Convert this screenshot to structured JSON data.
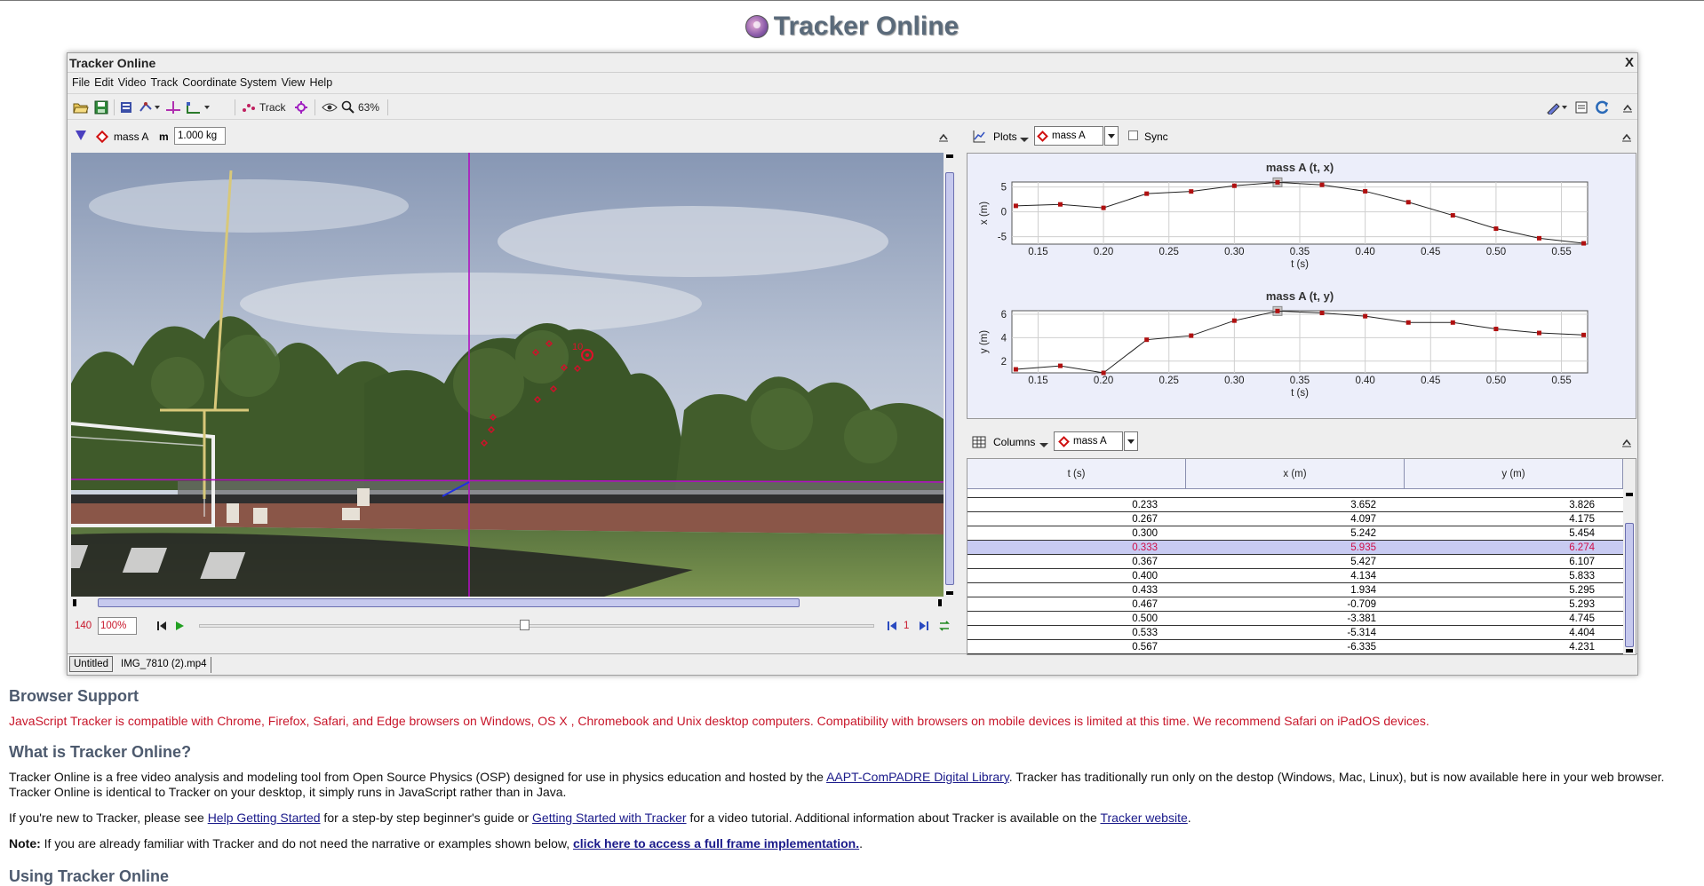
{
  "site": {
    "title": "Tracker Online"
  },
  "window": {
    "title": "Tracker Online",
    "close": "X"
  },
  "menu": [
    "File",
    "Edit",
    "Video",
    "Track",
    "Coordinate System",
    "View",
    "Help"
  ],
  "toolbar": {
    "track_label": "Track",
    "zoom": "63%"
  },
  "track_bar": {
    "name": "mass A",
    "mass_label": "m",
    "mass_value": "1.000 kg"
  },
  "player": {
    "frame": "140",
    "rate": "100%",
    "step": "1"
  },
  "tabs": [
    "Untitled",
    "IMG_7810 (2).mp4"
  ],
  "point_label": "10",
  "plots": {
    "label": "Plots",
    "track": "mass A",
    "sync": "Sync"
  },
  "chart_data": [
    {
      "type": "line",
      "title": "mass A (t, x)",
      "xlabel": "t (s)",
      "ylabel": "x (m)",
      "xlim": [
        0.13,
        0.57
      ],
      "ylim": [
        -6.5,
        6.0
      ],
      "xticks": [
        "0.15",
        "0.20",
        "0.25",
        "0.30",
        "0.35",
        "0.40",
        "0.45",
        "0.50",
        "0.55"
      ],
      "yticks": [
        "5",
        "0",
        "-5"
      ],
      "x": [
        0.133,
        0.167,
        0.2,
        0.233,
        0.267,
        0.3,
        0.333,
        0.367,
        0.4,
        0.433,
        0.467,
        0.5,
        0.533,
        0.567
      ],
      "y": [
        1.2,
        1.5,
        0.8,
        3.652,
        4.097,
        5.242,
        5.935,
        5.427,
        4.134,
        1.934,
        -0.709,
        -3.381,
        -5.314,
        -6.335
      ],
      "highlight_x": 0.333,
      "grid": true
    },
    {
      "type": "line",
      "title": "mass A (t, y)",
      "xlabel": "t (s)",
      "ylabel": "y (m)",
      "xlim": [
        0.13,
        0.57
      ],
      "ylim": [
        1.0,
        6.3
      ],
      "xticks": [
        "0.15",
        "0.20",
        "0.25",
        "0.30",
        "0.35",
        "0.40",
        "0.45",
        "0.50",
        "0.55"
      ],
      "yticks": [
        "6",
        "4",
        "2"
      ],
      "x": [
        0.133,
        0.167,
        0.2,
        0.233,
        0.267,
        0.3,
        0.333,
        0.367,
        0.4,
        0.433,
        0.467,
        0.5,
        0.533,
        0.567
      ],
      "y": [
        1.3,
        1.6,
        1.0,
        3.826,
        4.175,
        5.454,
        6.274,
        6.107,
        5.833,
        5.295,
        5.293,
        4.745,
        4.404,
        4.231
      ],
      "highlight_x": 0.333,
      "grid": true
    }
  ],
  "columns": {
    "label": "Columns",
    "track": "mass A",
    "headers": [
      "t (s)",
      "x (m)",
      "y (m)"
    ],
    "rows": [
      [
        "0.233",
        "3.652",
        "3.826"
      ],
      [
        "0.267",
        "4.097",
        "4.175"
      ],
      [
        "0.300",
        "5.242",
        "5.454"
      ],
      [
        "0.333",
        "5.935",
        "6.274"
      ],
      [
        "0.367",
        "5.427",
        "6.107"
      ],
      [
        "0.400",
        "4.134",
        "5.833"
      ],
      [
        "0.433",
        "1.934",
        "5.295"
      ],
      [
        "0.467",
        "-0.709",
        "5.293"
      ],
      [
        "0.500",
        "-3.381",
        "4.745"
      ],
      [
        "0.533",
        "-5.314",
        "4.404"
      ],
      [
        "0.567",
        "-6.335",
        "4.231"
      ]
    ],
    "selected_row": 3
  },
  "page": {
    "h_support": "Browser Support",
    "support_text": "JavaScript Tracker is compatible with Chrome, Firefox, Safari, and Edge browsers on Windows, OS X , Chromebook and Unix desktop computers. Compatibility with browsers on mobile devices is limited at this time. We recommend Safari on iPadOS devices.",
    "h_what": "What is Tracker Online?",
    "what_a": "Tracker Online is a free video analysis and modeling tool from Open Source Physics (OSP) designed for use in physics education and hosted by the ",
    "what_link": "AAPT-ComPADRE Digital Library",
    "what_b": ". Tracker has traditionally run only on the destop (Windows, Mac, Linux), but is now available here in your web browser. Tracker Online is identical to Tracker on your desktop, it simply runs in JavaScript rather than in Java.",
    "new_a": "If you're new to Tracker, please see ",
    "new_link1": "Help Getting Started",
    "new_b": " for a step-by step beginner's guide or ",
    "new_link2": "Getting Started with Tracker",
    "new_c": " for a video tutorial. Additional information about Tracker is available on the ",
    "new_link3": "Tracker website",
    "new_d": ".",
    "note_label": "Note:",
    "note_text": " If you are already familiar with Tracker and do not need the narrative or examples shown below, ",
    "note_link": "click here to access a full frame implementation.",
    "note_end": ".",
    "h_using": "Using Tracker Online"
  }
}
